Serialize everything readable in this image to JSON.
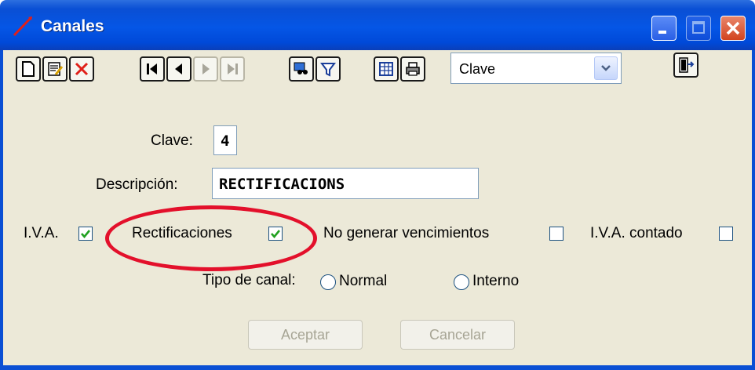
{
  "window": {
    "title": "Canales",
    "controls": [
      "minimize-icon",
      "maximize-icon",
      "close-icon"
    ],
    "app_icon": "red-slash-icon"
  },
  "toolbar": {
    "icons": [
      "new-document-icon",
      "edit-icon",
      "delete-icon",
      "first-record-icon",
      "previous-record-icon",
      "next-record-icon",
      "last-record-icon",
      "search-icon",
      "filter-icon",
      "grid-view-icon",
      "print-icon",
      "exit-door-icon"
    ],
    "sort_select": {
      "value": "Clave"
    }
  },
  "form": {
    "clave_label": "Clave:",
    "clave_value": "4",
    "descripcion_label": "Descripción:",
    "descripcion_value": "RECTIFICACIONS",
    "iva_label": "I.V.A.",
    "iva_checked": true,
    "rectificaciones_label": "Rectificaciones",
    "rectificaciones_checked": true,
    "no_generar_label": "No generar vencimientos",
    "no_generar_checked": false,
    "iva_contado_label": "I.V.A. contado",
    "iva_contado_checked": false,
    "tipo_canal_label": "Tipo de canal:",
    "tipo_options": [
      "Normal",
      "Interno"
    ]
  },
  "buttons": {
    "aceptar": "Aceptar",
    "cancelar": "Cancelar"
  },
  "colors": {
    "titlebar": "#0556e6",
    "frame": "#ece9d8",
    "highlight": "#e3102b",
    "check": "#21a121"
  }
}
